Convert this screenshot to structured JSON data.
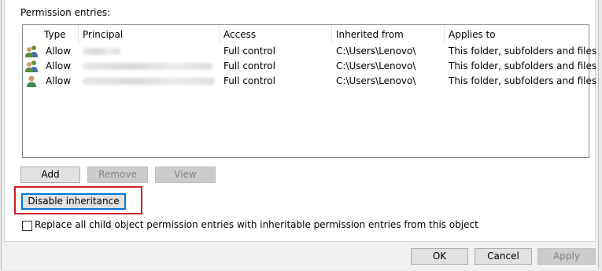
{
  "permission_entries_label": "Permission entries:",
  "columns": {
    "type": "Type",
    "principal": "Principal",
    "access": "Access",
    "inherited_from": "Inherited from",
    "applies_to": "Applies to"
  },
  "entries": [
    {
      "icon": "user-group-icon",
      "type": "Allow",
      "access": "Full control",
      "inherited_from": "C:\\Users\\Lenovo\\",
      "applies_to": "This folder, subfolders and files"
    },
    {
      "icon": "user-group-icon",
      "type": "Allow",
      "access": "Full control",
      "inherited_from": "C:\\Users\\Lenovo\\",
      "applies_to": "This folder, subfolders and files"
    },
    {
      "icon": "user-icon",
      "type": "Allow",
      "access": "Full control",
      "inherited_from": "C:\\Users\\Lenovo\\",
      "applies_to": "This folder, subfolders and files"
    }
  ],
  "buttons": {
    "add": "Add",
    "remove": "Remove",
    "view": "View",
    "disable_inheritance": "Disable inheritance",
    "ok": "OK",
    "cancel": "Cancel",
    "apply": "Apply"
  },
  "replace_checkbox": {
    "label": "Replace all child object permission entries with inheritable permission entries from this object",
    "checked": false
  },
  "colors": {
    "highlight": "#d21f26",
    "focus": "#0078d7"
  }
}
